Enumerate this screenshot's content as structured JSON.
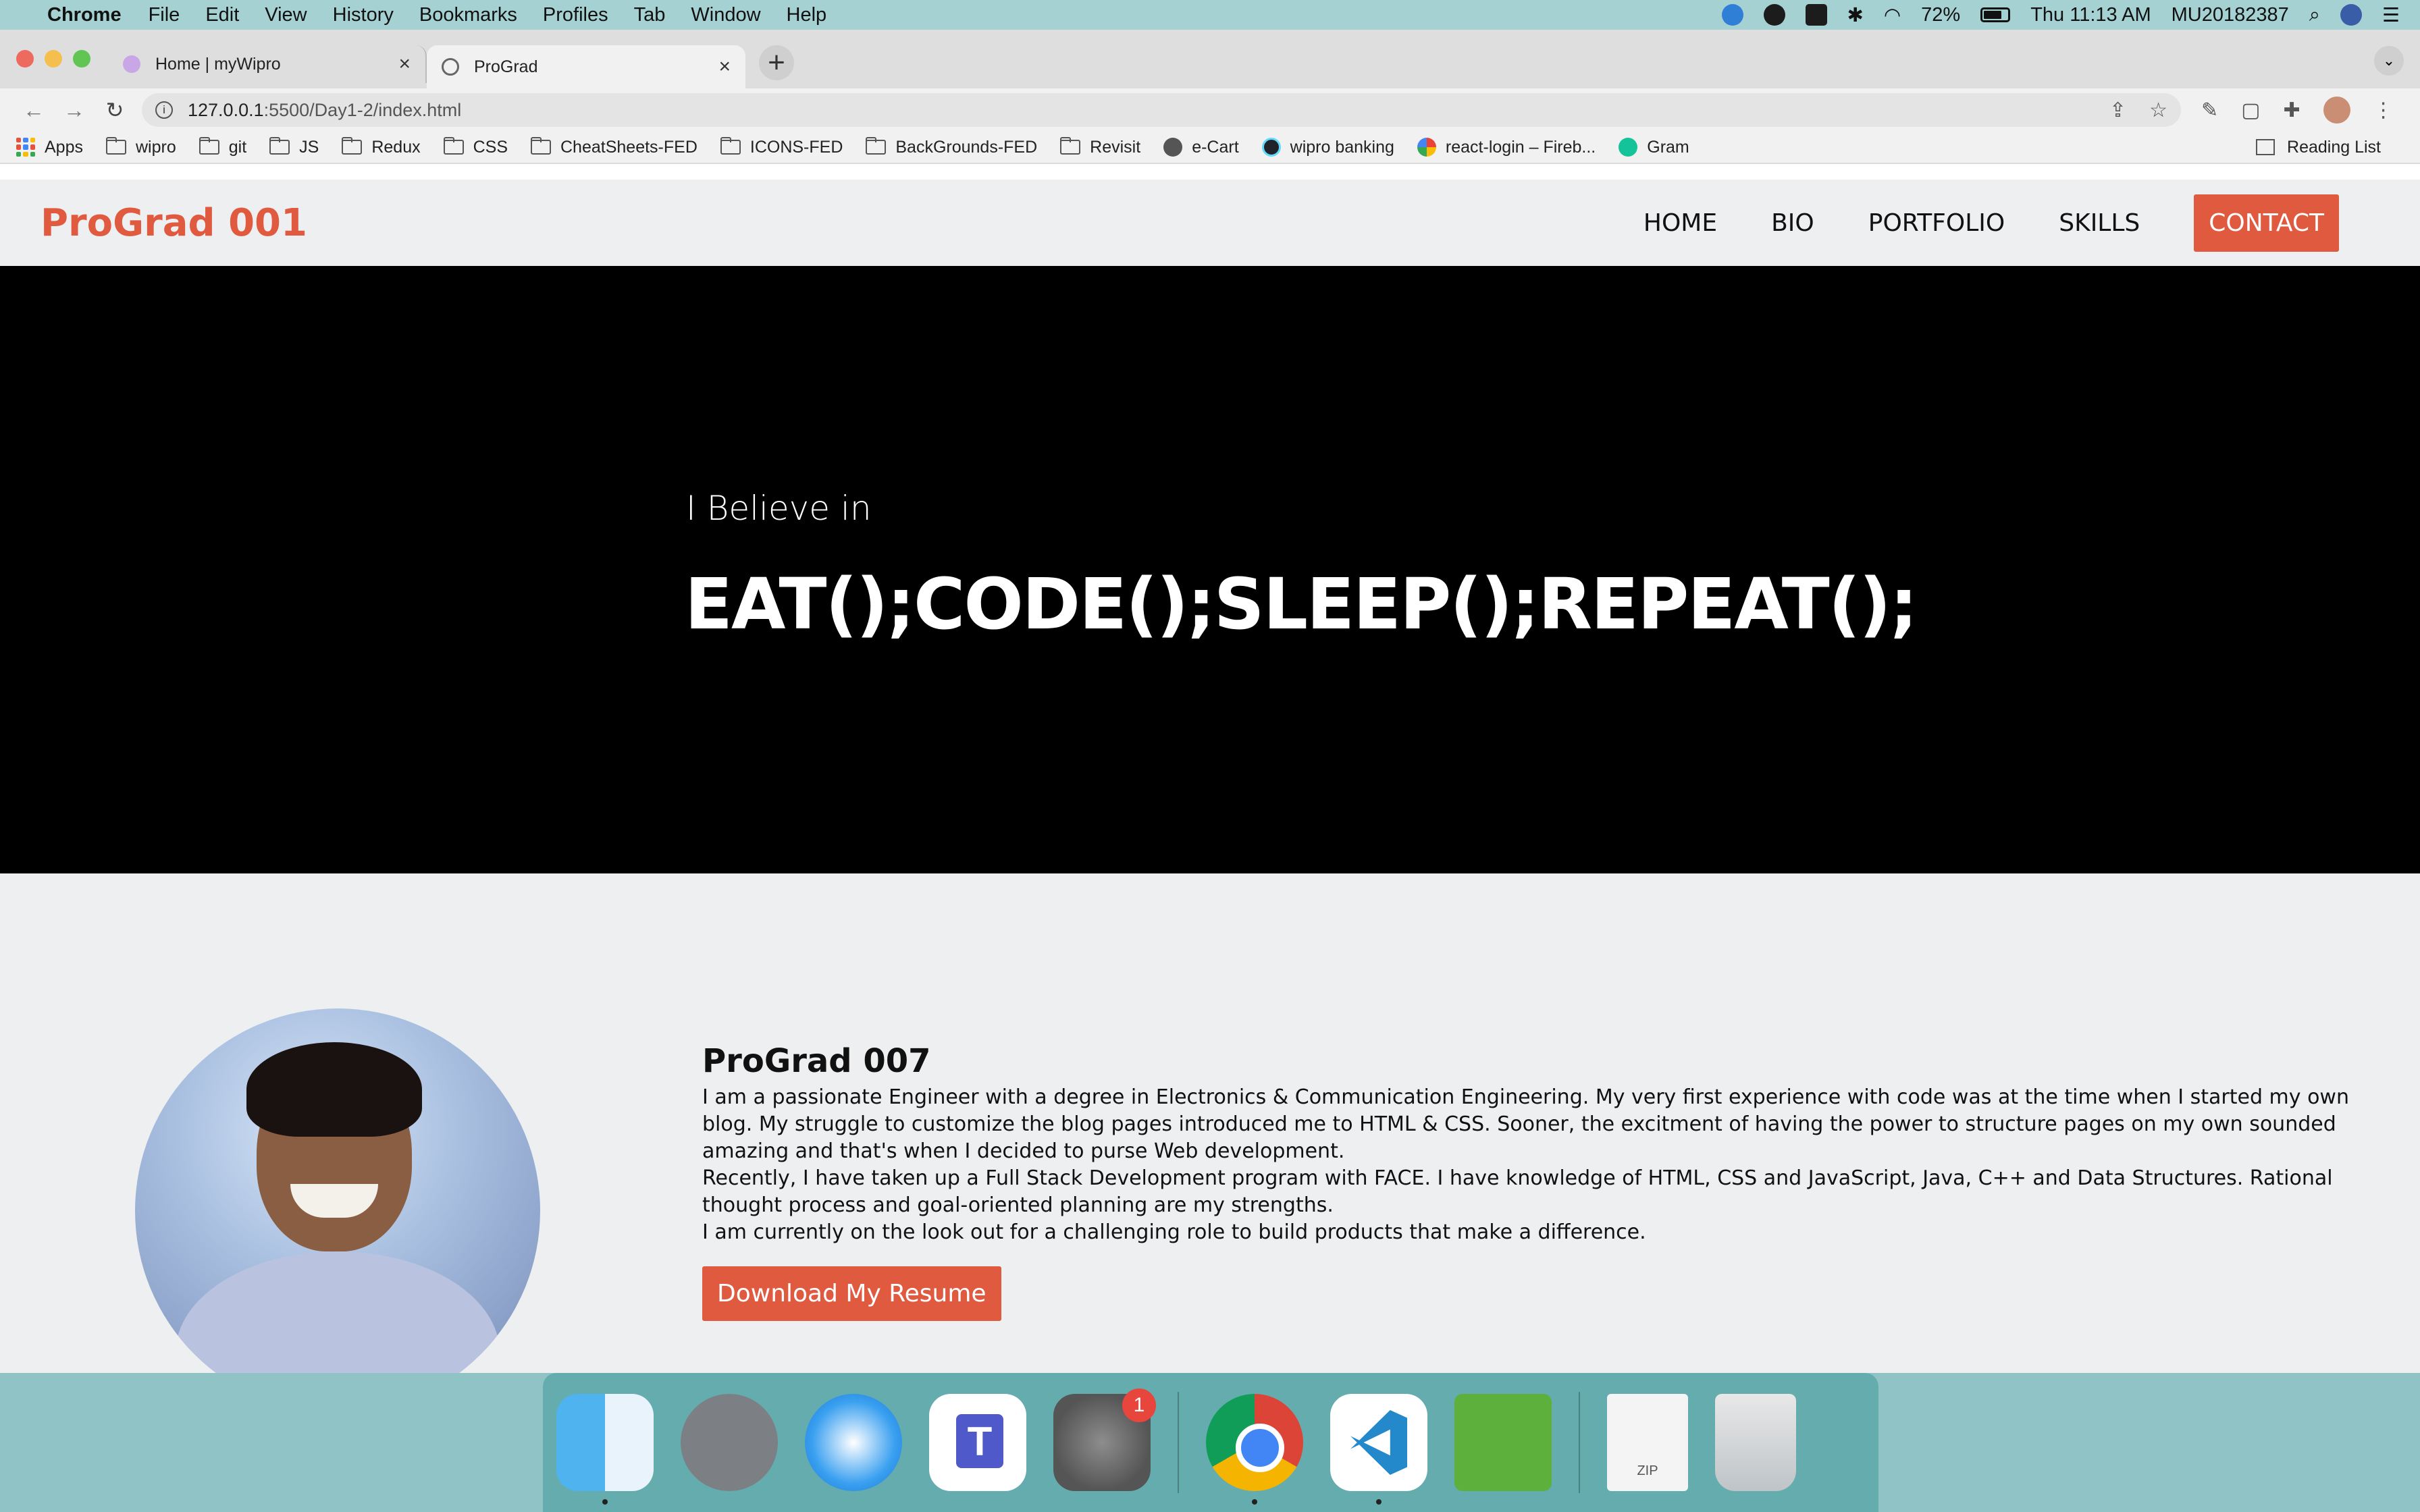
{
  "menubar": {
    "app_name": "Chrome",
    "menus": [
      "File",
      "Edit",
      "View",
      "History",
      "Bookmarks",
      "Profiles",
      "Tab",
      "Window",
      "Help"
    ],
    "battery": "72%",
    "clock": "Thu 11:13 AM",
    "user": "MU20182387"
  },
  "browser": {
    "tabs": [
      {
        "title": "Home | myWipro",
        "active": false,
        "close": "×"
      },
      {
        "title": "ProGrad",
        "active": true,
        "close": "×"
      }
    ],
    "new_tab": "+",
    "tab_menu": "⌄",
    "url_host": "127.0.0.1",
    "url_path": ":5500/Day1-2/index.html",
    "bookmarks": [
      {
        "label": "Apps",
        "icon": "apps-grid-icon"
      },
      {
        "label": "wipro",
        "icon": "folder-icon"
      },
      {
        "label": "git",
        "icon": "folder-icon"
      },
      {
        "label": "JS",
        "icon": "folder-icon"
      },
      {
        "label": "Redux",
        "icon": "folder-icon"
      },
      {
        "label": "CSS",
        "icon": "folder-icon"
      },
      {
        "label": "CheatSheets-FED",
        "icon": "folder-icon"
      },
      {
        "label": "ICONS-FED",
        "icon": "folder-icon"
      },
      {
        "label": "BackGrounds-FED",
        "icon": "folder-icon"
      },
      {
        "label": "Revisit",
        "icon": "folder-icon"
      },
      {
        "label": "e-Cart",
        "icon": "globe-icon"
      },
      {
        "label": "wipro banking",
        "icon": "react-icon"
      },
      {
        "label": "react-login – Fireb...",
        "icon": "google-icon"
      },
      {
        "label": "Gram",
        "icon": "grammarly-icon"
      }
    ],
    "reading_list": "Reading List"
  },
  "site": {
    "brand": "ProGrad 001",
    "nav": [
      "HOME",
      "BIO",
      "PORTFOLIO",
      "SKILLS"
    ],
    "contact": "CONTACT",
    "hero_small": "I Believe in",
    "hero_big": "EAT();CODE();SLEEP();REPEAT();",
    "about_name": "ProGrad 007",
    "about_p1": "I am a passionate Engineer with a degree in Electronics & Communication Engineering. My very first experience with code was at the time when I started my own blog. My struggle to customize the blog pages introduced me to HTML & CSS. Sooner, the excitment of having the power to structure pages on my own sounded amazing and that's when I decided to purse Web development.",
    "about_p2": "Recently, I have taken up a Full Stack Development program with FACE. I have knowledge of HTML, CSS and JavaScript, Java, C++ and Data Structures. Rational thought process and goal-oriented planning are my strengths.",
    "about_p3": "I am currently on the look out for a challenging role to build products that make a difference.",
    "resume_button": "Download My Resume"
  },
  "dock": {
    "prefs_badge": "1",
    "zip_label": "ZIP"
  },
  "colors": {
    "accent": "#e05a40",
    "hero_bg": "#000000",
    "page_bg": "#eeeff1"
  }
}
